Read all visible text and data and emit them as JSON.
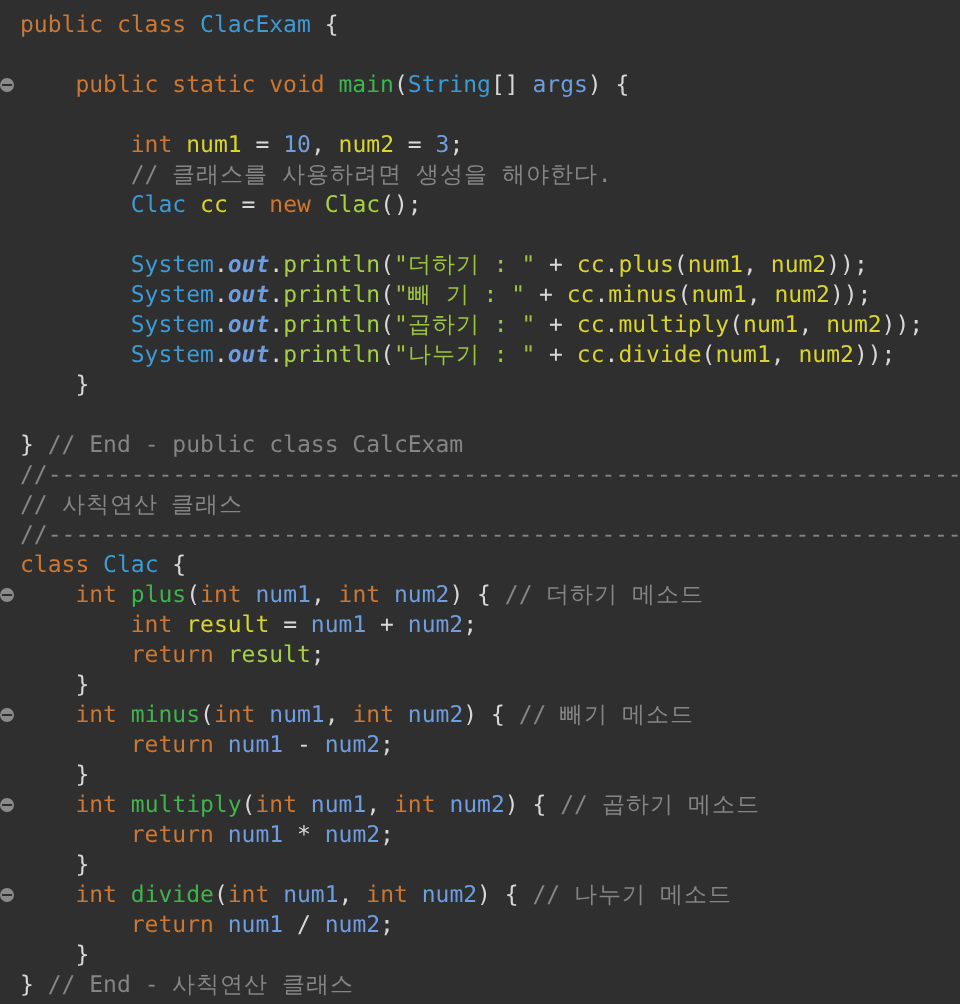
{
  "editor": {
    "lines": [
      {
        "fold": false,
        "tokens": [
          {
            "text": "public class ",
            "kind": "keyword"
          },
          {
            "text": "ClacExam",
            "kind": "type"
          },
          {
            "text": " {",
            "kind": "plain"
          }
        ]
      },
      {
        "fold": false
      },
      {
        "fold": true,
        "tokens": [
          {
            "text": "    public static void ",
            "kind": "keyword"
          },
          {
            "text": "main",
            "kind": "method"
          },
          {
            "text": "(",
            "kind": "plain"
          },
          {
            "text": "String",
            "kind": "type"
          },
          {
            "text": "[] ",
            "kind": "plain"
          },
          {
            "text": "args",
            "kind": "param"
          },
          {
            "text": ") {",
            "kind": "plain"
          }
        ]
      },
      {
        "fold": false
      },
      {
        "fold": false,
        "tokens": [
          {
            "text": "        int ",
            "kind": "keyword"
          },
          {
            "text": "num1",
            "kind": "local"
          },
          {
            "text": " = ",
            "kind": "plain"
          },
          {
            "text": "10",
            "kind": "number"
          },
          {
            "text": ", ",
            "kind": "plain"
          },
          {
            "text": "num2",
            "kind": "local"
          },
          {
            "text": " = ",
            "kind": "plain"
          },
          {
            "text": "3",
            "kind": "number"
          },
          {
            "text": ";",
            "kind": "plain"
          }
        ]
      },
      {
        "fold": false,
        "tokens": [
          {
            "text": "        // 클래스를 사용하려면 생성을 해야한다.",
            "kind": "comment"
          }
        ]
      },
      {
        "fold": false,
        "tokens": [
          {
            "text": "        Clac ",
            "kind": "type"
          },
          {
            "text": "cc",
            "kind": "local"
          },
          {
            "text": " = ",
            "kind": "plain"
          },
          {
            "text": "new ",
            "kind": "keyword"
          },
          {
            "text": "Clac",
            "kind": "call"
          },
          {
            "text": "();",
            "kind": "plain"
          }
        ]
      },
      {
        "fold": false
      },
      {
        "fold": false,
        "tokens": [
          {
            "text": "        System",
            "kind": "type"
          },
          {
            "text": ".",
            "kind": "plain"
          },
          {
            "text": "out",
            "kind": "field"
          },
          {
            "text": ".",
            "kind": "plain"
          },
          {
            "text": "println",
            "kind": "call"
          },
          {
            "text": "(",
            "kind": "plain"
          },
          {
            "text": "\"더하기 : \"",
            "kind": "string"
          },
          {
            "text": " + ",
            "kind": "plain"
          },
          {
            "text": "cc",
            "kind": "local"
          },
          {
            "text": ".",
            "kind": "plain"
          },
          {
            "text": "plus",
            "kind": "local"
          },
          {
            "text": "(",
            "kind": "plain"
          },
          {
            "text": "num1",
            "kind": "local"
          },
          {
            "text": ", ",
            "kind": "plain"
          },
          {
            "text": "num2",
            "kind": "local"
          },
          {
            "text": "));",
            "kind": "plain"
          }
        ]
      },
      {
        "fold": false,
        "tokens": [
          {
            "text": "        System",
            "kind": "type"
          },
          {
            "text": ".",
            "kind": "plain"
          },
          {
            "text": "out",
            "kind": "field"
          },
          {
            "text": ".",
            "kind": "plain"
          },
          {
            "text": "println",
            "kind": "call"
          },
          {
            "text": "(",
            "kind": "plain"
          },
          {
            "text": "\"빼 기 : \"",
            "kind": "string"
          },
          {
            "text": " + ",
            "kind": "plain"
          },
          {
            "text": "cc",
            "kind": "local"
          },
          {
            "text": ".",
            "kind": "plain"
          },
          {
            "text": "minus",
            "kind": "local"
          },
          {
            "text": "(",
            "kind": "plain"
          },
          {
            "text": "num1",
            "kind": "local"
          },
          {
            "text": ", ",
            "kind": "plain"
          },
          {
            "text": "num2",
            "kind": "local"
          },
          {
            "text": "));",
            "kind": "plain"
          }
        ]
      },
      {
        "fold": false,
        "tokens": [
          {
            "text": "        System",
            "kind": "type"
          },
          {
            "text": ".",
            "kind": "plain"
          },
          {
            "text": "out",
            "kind": "field"
          },
          {
            "text": ".",
            "kind": "plain"
          },
          {
            "text": "println",
            "kind": "call"
          },
          {
            "text": "(",
            "kind": "plain"
          },
          {
            "text": "\"곱하기 : \"",
            "kind": "string"
          },
          {
            "text": " + ",
            "kind": "plain"
          },
          {
            "text": "cc",
            "kind": "local"
          },
          {
            "text": ".",
            "kind": "plain"
          },
          {
            "text": "multiply",
            "kind": "local"
          },
          {
            "text": "(",
            "kind": "plain"
          },
          {
            "text": "num1",
            "kind": "local"
          },
          {
            "text": ", ",
            "kind": "plain"
          },
          {
            "text": "num2",
            "kind": "local"
          },
          {
            "text": "));",
            "kind": "plain"
          }
        ]
      },
      {
        "fold": false,
        "tokens": [
          {
            "text": "        System",
            "kind": "type"
          },
          {
            "text": ".",
            "kind": "plain"
          },
          {
            "text": "out",
            "kind": "field"
          },
          {
            "text": ".",
            "kind": "plain"
          },
          {
            "text": "println",
            "kind": "call"
          },
          {
            "text": "(",
            "kind": "plain"
          },
          {
            "text": "\"나누기 : \"",
            "kind": "string"
          },
          {
            "text": " + ",
            "kind": "plain"
          },
          {
            "text": "cc",
            "kind": "local"
          },
          {
            "text": ".",
            "kind": "plain"
          },
          {
            "text": "divide",
            "kind": "local"
          },
          {
            "text": "(",
            "kind": "plain"
          },
          {
            "text": "num1",
            "kind": "local"
          },
          {
            "text": ", ",
            "kind": "plain"
          },
          {
            "text": "num2",
            "kind": "local"
          },
          {
            "text": "));",
            "kind": "plain"
          }
        ]
      },
      {
        "fold": false,
        "tokens": [
          {
            "text": "    }",
            "kind": "plain"
          }
        ]
      },
      {
        "fold": false
      },
      {
        "fold": false,
        "tokens": [
          {
            "text": "} ",
            "kind": "plain"
          },
          {
            "text": "// End - public class CalcExam",
            "kind": "comment"
          }
        ]
      },
      {
        "fold": false,
        "tokens": [
          {
            "text": "//------------------------------------------------------------------",
            "kind": "comment"
          }
        ]
      },
      {
        "fold": false,
        "tokens": [
          {
            "text": "// 사칙연산 클래스",
            "kind": "comment"
          }
        ]
      },
      {
        "fold": false,
        "tokens": [
          {
            "text": "//------------------------------------------------------------------",
            "kind": "comment"
          }
        ]
      },
      {
        "fold": false,
        "tokens": [
          {
            "text": "class ",
            "kind": "keyword"
          },
          {
            "text": "Clac",
            "kind": "type"
          },
          {
            "text": " {",
            "kind": "plain"
          }
        ]
      },
      {
        "fold": true,
        "tokens": [
          {
            "text": "    int ",
            "kind": "keyword"
          },
          {
            "text": "plus",
            "kind": "method"
          },
          {
            "text": "(",
            "kind": "plain"
          },
          {
            "text": "int ",
            "kind": "keyword"
          },
          {
            "text": "num1",
            "kind": "param"
          },
          {
            "text": ", ",
            "kind": "plain"
          },
          {
            "text": "int ",
            "kind": "keyword"
          },
          {
            "text": "num2",
            "kind": "param"
          },
          {
            "text": ") { ",
            "kind": "plain"
          },
          {
            "text": "// 더하기 메소드",
            "kind": "comment"
          }
        ]
      },
      {
        "fold": false,
        "tokens": [
          {
            "text": "        int ",
            "kind": "keyword"
          },
          {
            "text": "result",
            "kind": "local"
          },
          {
            "text": " = ",
            "kind": "plain"
          },
          {
            "text": "num1",
            "kind": "param"
          },
          {
            "text": " + ",
            "kind": "plain"
          },
          {
            "text": "num2",
            "kind": "param"
          },
          {
            "text": ";",
            "kind": "plain"
          }
        ]
      },
      {
        "fold": false,
        "tokens": [
          {
            "text": "        return ",
            "kind": "keyword"
          },
          {
            "text": "result",
            "kind": "call"
          },
          {
            "text": ";",
            "kind": "plain"
          }
        ]
      },
      {
        "fold": false,
        "tokens": [
          {
            "text": "    }",
            "kind": "plain"
          }
        ]
      },
      {
        "fold": true,
        "tokens": [
          {
            "text": "    int ",
            "kind": "keyword"
          },
          {
            "text": "minus",
            "kind": "method"
          },
          {
            "text": "(",
            "kind": "plain"
          },
          {
            "text": "int ",
            "kind": "keyword"
          },
          {
            "text": "num1",
            "kind": "param"
          },
          {
            "text": ", ",
            "kind": "plain"
          },
          {
            "text": "int ",
            "kind": "keyword"
          },
          {
            "text": "num2",
            "kind": "param"
          },
          {
            "text": ") { ",
            "kind": "plain"
          },
          {
            "text": "// 빼기 메소드",
            "kind": "comment"
          }
        ]
      },
      {
        "fold": false,
        "tokens": [
          {
            "text": "        return ",
            "kind": "keyword"
          },
          {
            "text": "num1",
            "kind": "param"
          },
          {
            "text": " - ",
            "kind": "plain"
          },
          {
            "text": "num2",
            "kind": "param"
          },
          {
            "text": ";",
            "kind": "plain"
          }
        ]
      },
      {
        "fold": false,
        "tokens": [
          {
            "text": "    }",
            "kind": "plain"
          }
        ]
      },
      {
        "fold": true,
        "tokens": [
          {
            "text": "    int ",
            "kind": "keyword"
          },
          {
            "text": "multiply",
            "kind": "method"
          },
          {
            "text": "(",
            "kind": "plain"
          },
          {
            "text": "int ",
            "kind": "keyword"
          },
          {
            "text": "num1",
            "kind": "param"
          },
          {
            "text": ", ",
            "kind": "plain"
          },
          {
            "text": "int ",
            "kind": "keyword"
          },
          {
            "text": "num2",
            "kind": "param"
          },
          {
            "text": ") { ",
            "kind": "plain"
          },
          {
            "text": "// 곱하기 메소드",
            "kind": "comment"
          }
        ]
      },
      {
        "fold": false,
        "tokens": [
          {
            "text": "        return ",
            "kind": "keyword"
          },
          {
            "text": "num1",
            "kind": "param"
          },
          {
            "text": " * ",
            "kind": "plain"
          },
          {
            "text": "num2",
            "kind": "param"
          },
          {
            "text": ";",
            "kind": "plain"
          }
        ]
      },
      {
        "fold": false,
        "tokens": [
          {
            "text": "    }",
            "kind": "plain"
          }
        ]
      },
      {
        "fold": true,
        "tokens": [
          {
            "text": "    int ",
            "kind": "keyword"
          },
          {
            "text": "divide",
            "kind": "method"
          },
          {
            "text": "(",
            "kind": "plain"
          },
          {
            "text": "int ",
            "kind": "keyword"
          },
          {
            "text": "num1",
            "kind": "param"
          },
          {
            "text": ", ",
            "kind": "plain"
          },
          {
            "text": "int ",
            "kind": "keyword"
          },
          {
            "text": "num2",
            "kind": "param"
          },
          {
            "text": ") { ",
            "kind": "plain"
          },
          {
            "text": "// 나누기 메소드",
            "kind": "comment"
          }
        ]
      },
      {
        "fold": false,
        "tokens": [
          {
            "text": "        return ",
            "kind": "keyword"
          },
          {
            "text": "num1",
            "kind": "param"
          },
          {
            "text": " / ",
            "kind": "plain"
          },
          {
            "text": "num2",
            "kind": "param"
          },
          {
            "text": ";",
            "kind": "plain"
          }
        ]
      },
      {
        "fold": false,
        "tokens": [
          {
            "text": "    }",
            "kind": "plain"
          }
        ]
      },
      {
        "fold": false,
        "tokens": [
          {
            "text": "} ",
            "kind": "plain"
          },
          {
            "text": "// End - 사칙연산 클래스",
            "kind": "comment"
          }
        ]
      }
    ]
  }
}
